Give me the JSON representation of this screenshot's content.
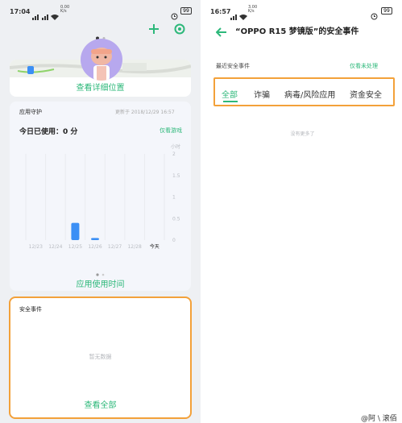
{
  "left": {
    "status": {
      "time": "17:04",
      "net": "0.00\nK/s",
      "battery": "99"
    },
    "location": {
      "link": "查看详细位置"
    },
    "app_guard": {
      "title": "应用守护",
      "updated": "更新于 2018/12/29 16:57",
      "today_usage": "今日已使用：0 分",
      "games_only": "仅看游戏",
      "unit": "小时",
      "footer_link": "应用使用时间"
    },
    "security": {
      "title": "安全事件",
      "empty": "暂无数据",
      "view_all": "查看全部"
    }
  },
  "right": {
    "status": {
      "time": "16:57",
      "net": "3.00\nK/s",
      "battery": "99"
    },
    "title": "“OPPO R15 梦镜版”的安全事件",
    "recent_label": "最近安全事件",
    "unhandled_link": "仅看未处理",
    "tabs": [
      "全部",
      "诈骗",
      "病毒/风险应用",
      "资金安全"
    ],
    "empty": "没有更多了"
  },
  "watermark": "@阿 \\ 滚佰",
  "chart_data": {
    "type": "bar",
    "categories": [
      "12/23",
      "12/24",
      "12/25",
      "12/26",
      "12/27",
      "12/28",
      "今天"
    ],
    "values": [
      0,
      0,
      0.4,
      0.05,
      0,
      0,
      0
    ],
    "ylim": [
      0,
      2
    ],
    "yticks": [
      "2",
      "1.5",
      "1",
      "0.5",
      "0"
    ],
    "ylabel": "小时",
    "color": "#3b8ff5",
    "grid": true
  }
}
